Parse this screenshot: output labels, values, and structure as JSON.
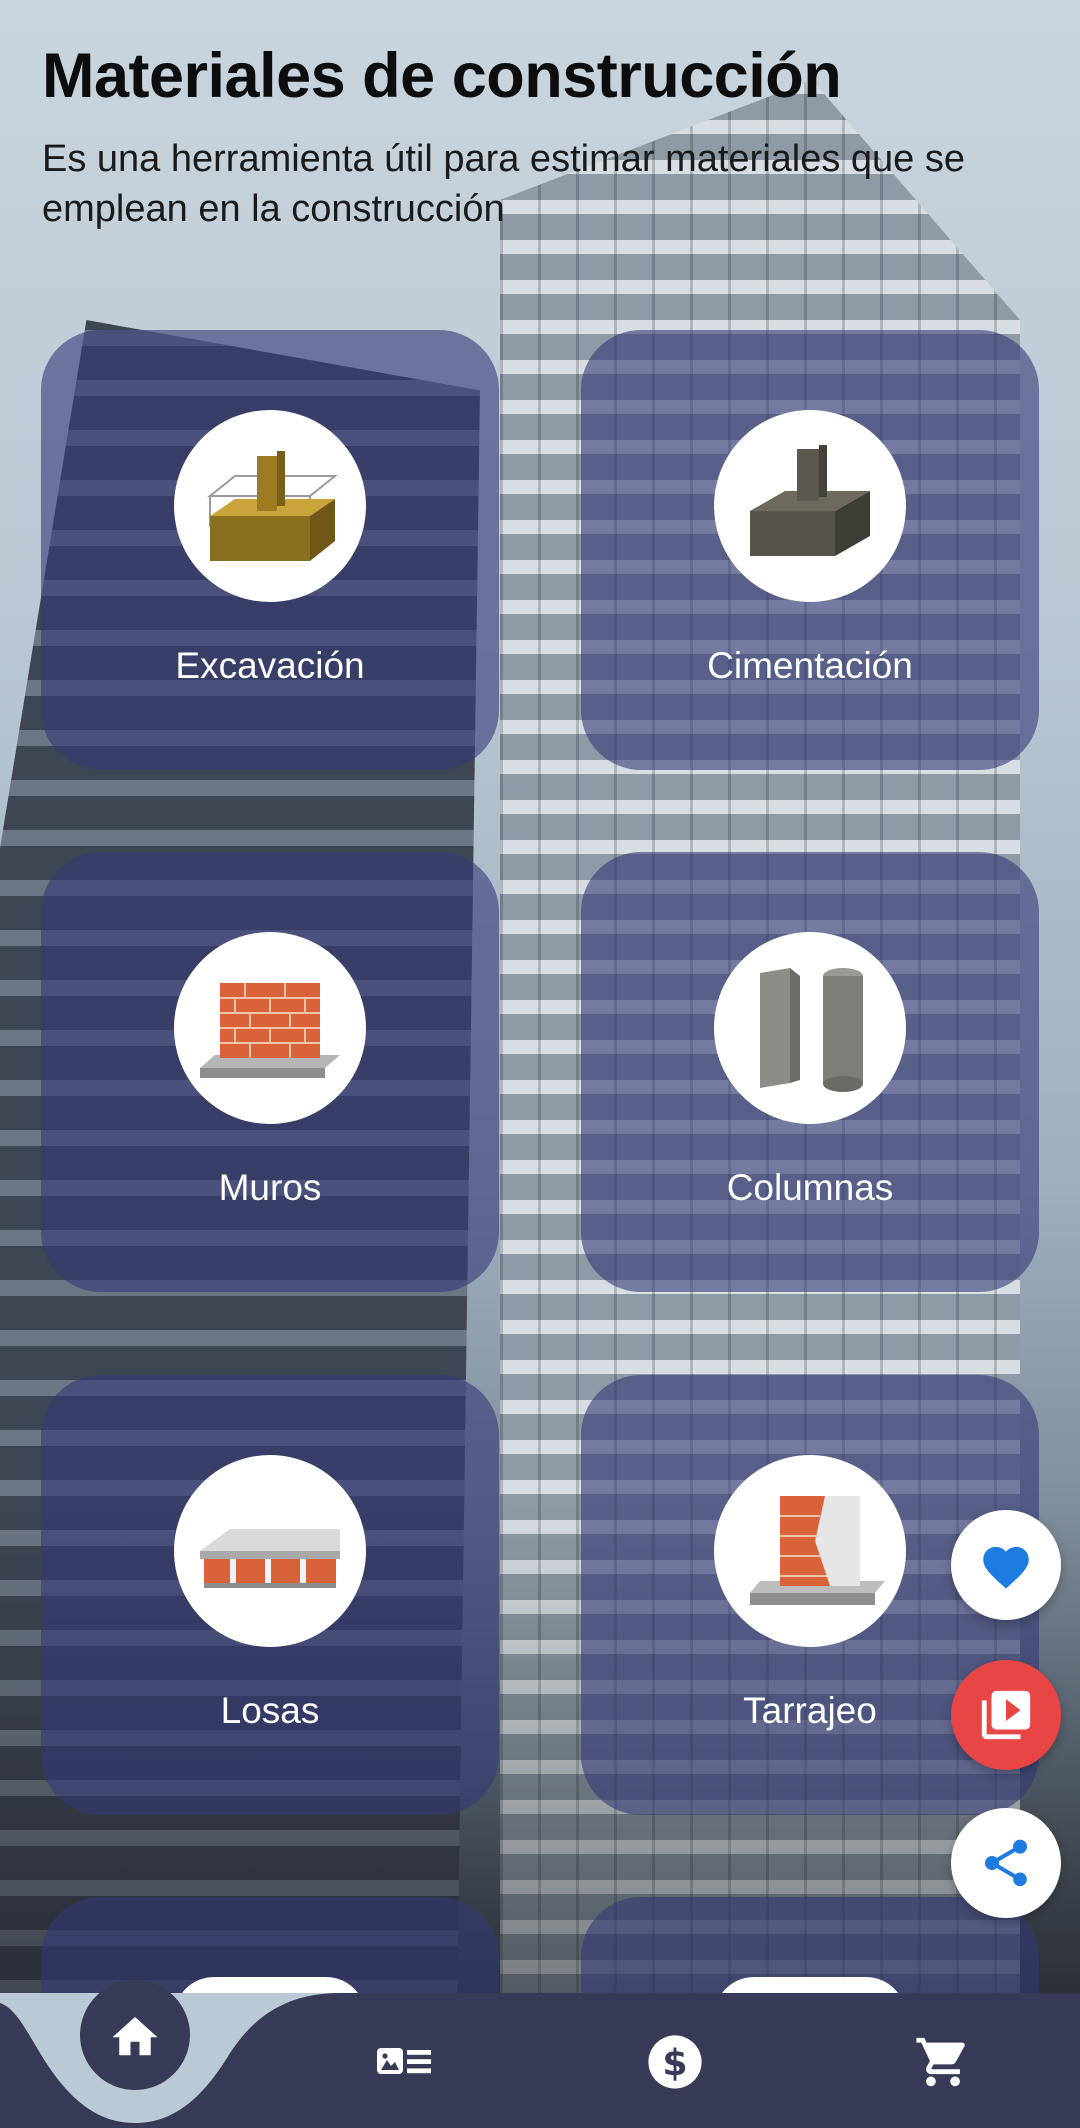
{
  "header": {
    "title": "Materiales de construcción",
    "subtitle": "Es una herramienta útil para estimar materiales que se emplean en la construcción"
  },
  "cards": [
    {
      "label": "Excavación",
      "icon": "excavation-icon"
    },
    {
      "label": "Cimentación",
      "icon": "foundation-icon"
    },
    {
      "label": "Muros",
      "icon": "brick-wall-icon"
    },
    {
      "label": "Columnas",
      "icon": "columns-icon"
    },
    {
      "label": "Losas",
      "icon": "slab-icon"
    },
    {
      "label": "Tarrajeo",
      "icon": "plaster-icon"
    }
  ],
  "fabs": {
    "favorite": "heart-icon",
    "video": "video-library-icon",
    "share": "share-icon"
  },
  "nav": {
    "items": [
      "home-icon",
      "catalog-icon",
      "dollar-icon",
      "cart-icon"
    ],
    "active": "home-icon"
  },
  "colors": {
    "card_overlay": "#343876",
    "nav_bg": "#383b57",
    "nav_curve": "#b9cad6",
    "fab_red": "#e84545",
    "heart_blue": "#1e7be0"
  }
}
